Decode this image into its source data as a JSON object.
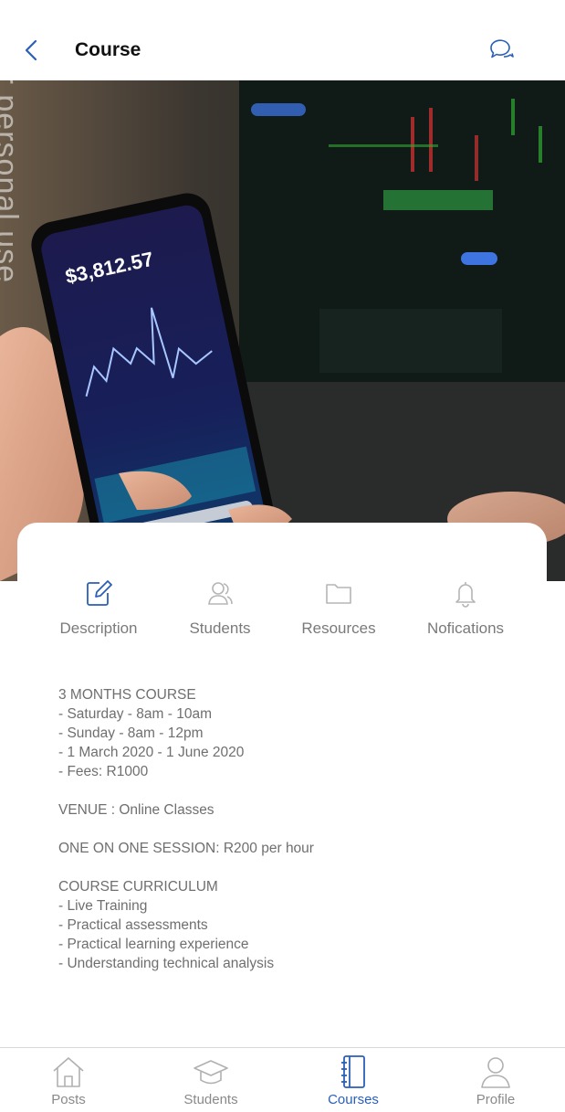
{
  "header": {
    "title": "Course",
    "watermark": "ee for personal use"
  },
  "hero": {
    "phone_amount": "$3,812.57"
  },
  "tabs": [
    {
      "label": "Description",
      "icon": "edit-icon",
      "active": true
    },
    {
      "label": "Students",
      "icon": "users-icon",
      "active": false
    },
    {
      "label": "Resources",
      "icon": "folder-icon",
      "active": false
    },
    {
      "label": "Nofications",
      "icon": "bell-icon",
      "active": false
    }
  ],
  "description": {
    "block1": [
      "3 MONTHS COURSE",
      "- Saturday - 8am - 10am",
      "- Sunday  - 8am - 12pm",
      "- 1 March 2020 - 1 June 2020",
      "- Fees: R1000"
    ],
    "venue": "VENUE : Online Classes",
    "session": "ONE ON ONE SESSION: R200 per hour",
    "curriculum": [
      "COURSE CURRICULUM",
      "- Live Training",
      "- Practical assessments",
      "- Practical learning experience",
      "- Understanding technical analysis"
    ]
  },
  "bottom_nav": [
    {
      "label": "Posts",
      "icon": "home-icon",
      "active": false
    },
    {
      "label": "Students",
      "icon": "graduation-cap-icon",
      "active": false
    },
    {
      "label": "Courses",
      "icon": "notebook-icon",
      "active": true
    },
    {
      "label": "Profile",
      "icon": "user-icon",
      "active": false
    }
  ],
  "colors": {
    "accent": "#2a5fb8",
    "inactive": "#8a8a8a"
  }
}
